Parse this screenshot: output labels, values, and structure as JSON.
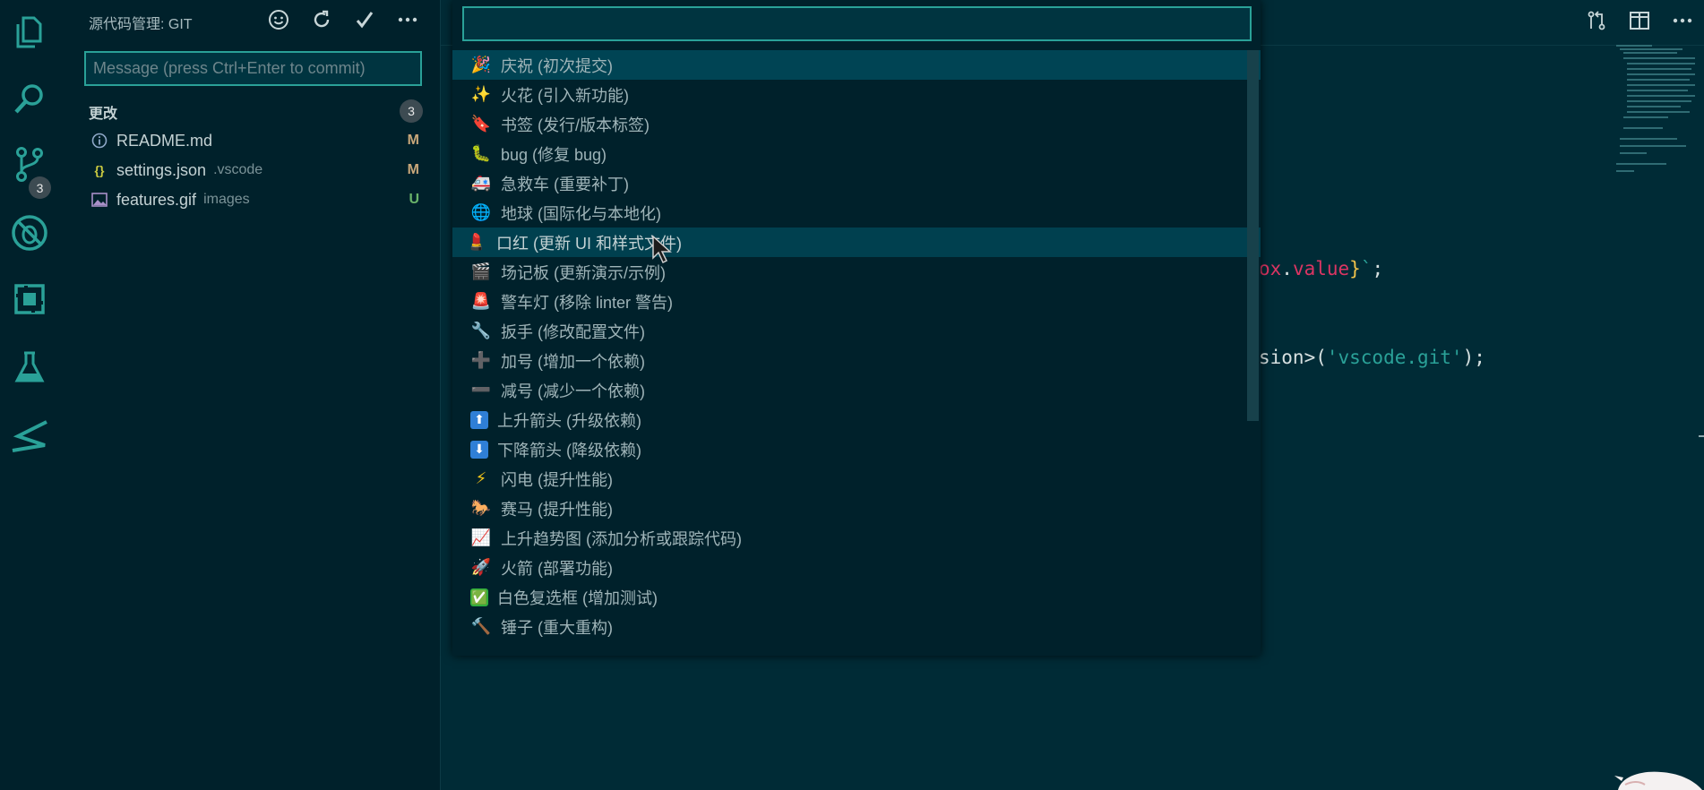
{
  "sidebar": {
    "title": "源代码管理: GIT",
    "actions": [
      {
        "icon": "smiley-icon"
      },
      {
        "icon": "refresh-icon"
      },
      {
        "icon": "check-icon"
      },
      {
        "icon": "more-icon"
      }
    ],
    "commit_placeholder": "Message (press Ctrl+Enter to commit)",
    "section_label": "更改",
    "section_count": "3",
    "files": [
      {
        "icon": "info-icon",
        "name": "README.md",
        "dir": "",
        "status": "M",
        "status_color": "#c8a77a"
      },
      {
        "icon": "json-icon",
        "name": "settings.json",
        "dir": ".vscode",
        "status": "M",
        "status_color": "#c8a77a"
      },
      {
        "icon": "image-icon",
        "name": "features.gif",
        "dir": "images",
        "status": "U",
        "status_color": "#69b36a"
      }
    ]
  },
  "activity_bar": {
    "items": [
      "explorer-icon",
      "search-icon",
      "source-control-icon",
      "debug-icon",
      "extensions-icon",
      "testing-icon",
      "gitlens-icon"
    ],
    "scm_badge": "3"
  },
  "quick_pick": {
    "input_value": "",
    "items": [
      {
        "emoji": "🎉",
        "label": "庆祝 (初次提交)"
      },
      {
        "emoji": "✨",
        "label": "火花 (引入新功能)"
      },
      {
        "emoji": "🔖",
        "label": "书签 (发行/版本标签)"
      },
      {
        "emoji": "🐛",
        "label": "bug (修复 bug)"
      },
      {
        "emoji": "🚑",
        "label": "急救车 (重要补丁)"
      },
      {
        "emoji": "🌐",
        "label": "地球 (国际化与本地化)"
      },
      {
        "emoji": "💄",
        "label": "口红 (更新 UI 和样式文件)"
      },
      {
        "emoji": "🎬",
        "label": "场记板 (更新演示/示例)"
      },
      {
        "emoji": "🚨",
        "label": "警车灯 (移除 linter 警告)"
      },
      {
        "emoji": "🔧",
        "label": "扳手 (修改配置文件)"
      },
      {
        "emoji": "➕",
        "label": "加号 (增加一个依赖)"
      },
      {
        "emoji": "➖",
        "label": "减号 (减少一个依赖)"
      },
      {
        "emoji": "⬆",
        "label": "上升箭头 (升级依赖)"
      },
      {
        "emoji": "⬇",
        "label": "下降箭头 (降级依赖)"
      },
      {
        "emoji": "⚡",
        "label": "闪电 (提升性能)"
      },
      {
        "emoji": "🐎",
        "label": "赛马 (提升性能)"
      },
      {
        "emoji": "📈",
        "label": "上升趋势图 (添加分析或跟踪代码)"
      },
      {
        "emoji": "🚀",
        "label": "火箭 (部署功能)"
      },
      {
        "emoji": "✅",
        "label": "白色复选框 (增加测试)"
      },
      {
        "emoji": "🔨",
        "label": "锤子 (重大重构)"
      }
    ]
  },
  "editor": {
    "line1": {
      "a": "ox",
      "b": ".",
      "c": "value",
      "d": "}",
      "e": "`",
      "f": ";"
    },
    "line2": {
      "a": "sion>(",
      "b": "'vscode.git'",
      "c": ");"
    },
    "actions": [
      "open-changes-icon",
      "split-editor-icon",
      "more-icon"
    ]
  },
  "colors": {
    "accent": "#2aa198",
    "background": "#002b36",
    "sidebar": "#00212b",
    "selection": "#004454"
  }
}
